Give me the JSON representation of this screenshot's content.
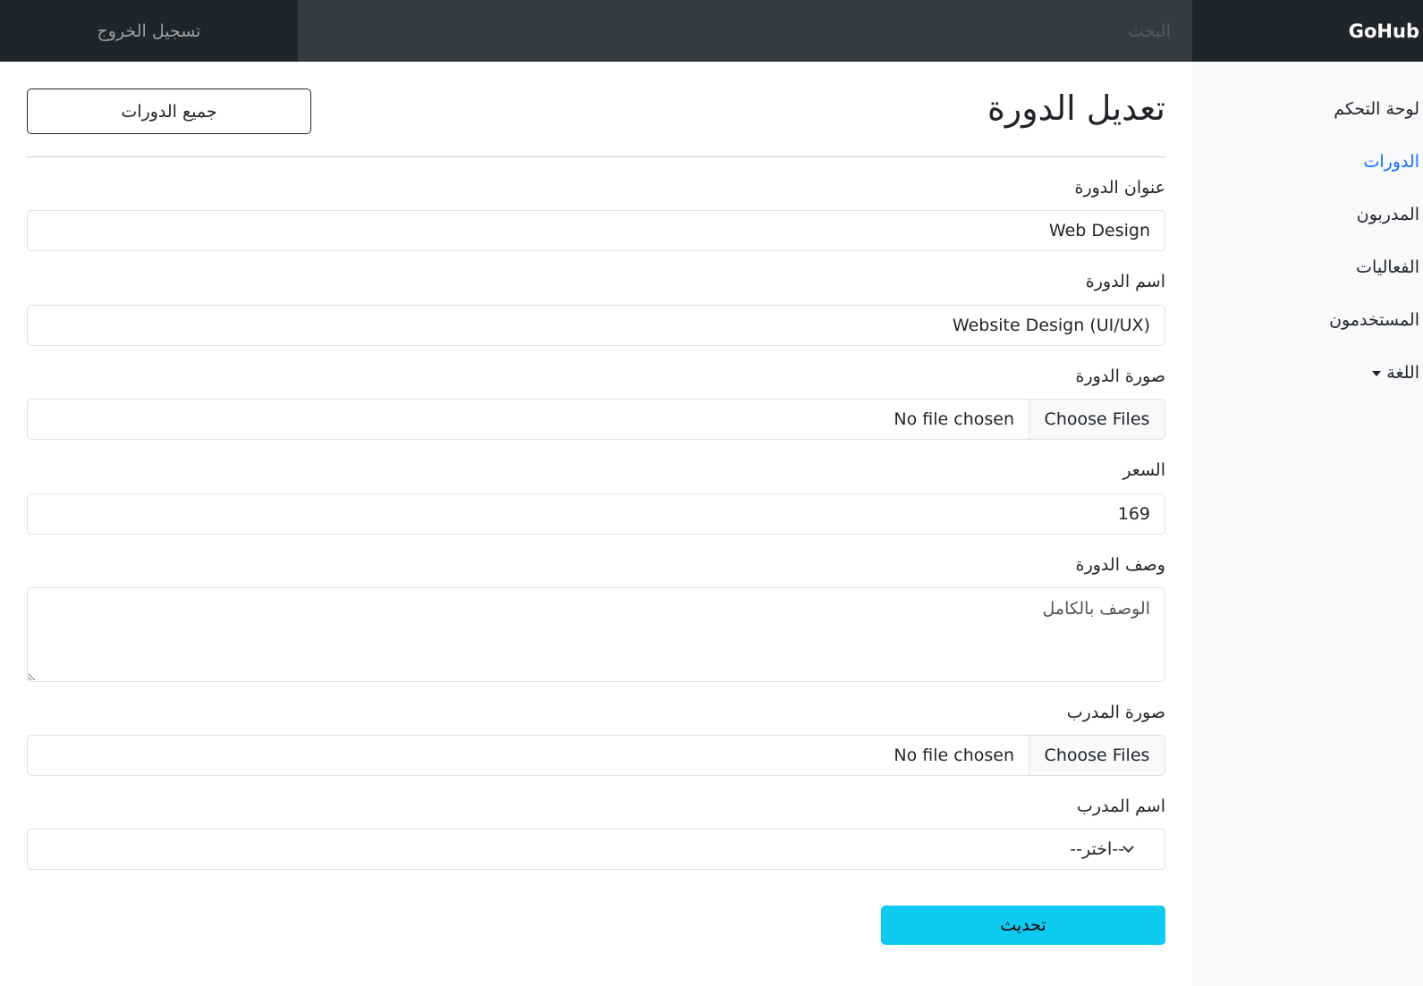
{
  "navbar": {
    "brand": "GoHub",
    "search_placeholder": "البحث",
    "logout_label": "تسجيل الخروج"
  },
  "sidebar": {
    "items": [
      {
        "label": "لوحة التحكم",
        "active": false
      },
      {
        "label": "الدورات",
        "active": true
      },
      {
        "label": "المدربون",
        "active": false
      },
      {
        "label": "الفعاليات",
        "active": false
      },
      {
        "label": "المستخدمون",
        "active": false
      },
      {
        "label": "اللغة",
        "active": false
      }
    ]
  },
  "main": {
    "title": "تعديل الدورة",
    "all_courses_label": "جميع الدورات",
    "form": {
      "course_title_label": "عنوان الدورة",
      "course_title_value": "Web Design",
      "course_name_label": "اسم الدورة",
      "course_name_value": "Website Design (UI/UX)",
      "course_image_label": "صورة الدورة",
      "price_label": "السعر",
      "price_value": "169",
      "description_label": "وصف الدورة",
      "description_placeholder": "الوصف بالكامل",
      "trainer_image_label": "صورة المدرب",
      "trainer_name_label": "اسم المدرب",
      "trainer_name_selected": "--اختر--",
      "file_button_label": "Choose Files",
      "file_status": "No file chosen",
      "submit_label": "تحديث"
    }
  },
  "colors": {
    "navbar": "#212529",
    "search_bg": "#373a3f",
    "sidebar_bg": "#f8f9fa",
    "active_link": "#0d6efd",
    "update_button": "#0dcaf0"
  }
}
